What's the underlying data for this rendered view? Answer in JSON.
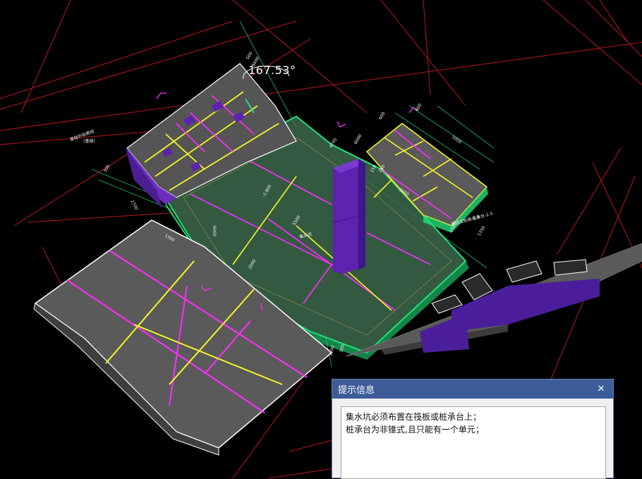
{
  "viewport": {
    "angle_readout": "167.53°",
    "colors": {
      "background": "#000000",
      "slab": "#636363",
      "outline": "#ffffff",
      "axis_yellow": "#f5f528",
      "axis_magenta": "#ff2dff",
      "beam_green": "#22e07a",
      "raft_tint": "#3f6b4f",
      "core_purple": "#5a22a8",
      "site_red": "#c01818"
    },
    "dimension_labels": [
      "500",
      "600",
      "8400",
      "3000",
      "5000",
      "6000",
      "4705",
      "2700",
      "6000",
      "600",
      "1500",
      "300",
      "150",
      "250",
      "1500",
      "5500",
      "300",
      "1350",
      "2000",
      "1300"
    ],
    "annotations": [
      "基础外轮廓线",
      "(基础)",
      "基础底标高-2.8",
      "桩承台-2.5",
      "-3.800",
      "集水坑"
    ]
  },
  "dialog": {
    "title": "提示信息",
    "close_glyph": "✕",
    "messages": [
      "集水坑必须布置在筏板或桩承台上；",
      "桩承台为非锥式,且只能有一个单元；"
    ]
  }
}
